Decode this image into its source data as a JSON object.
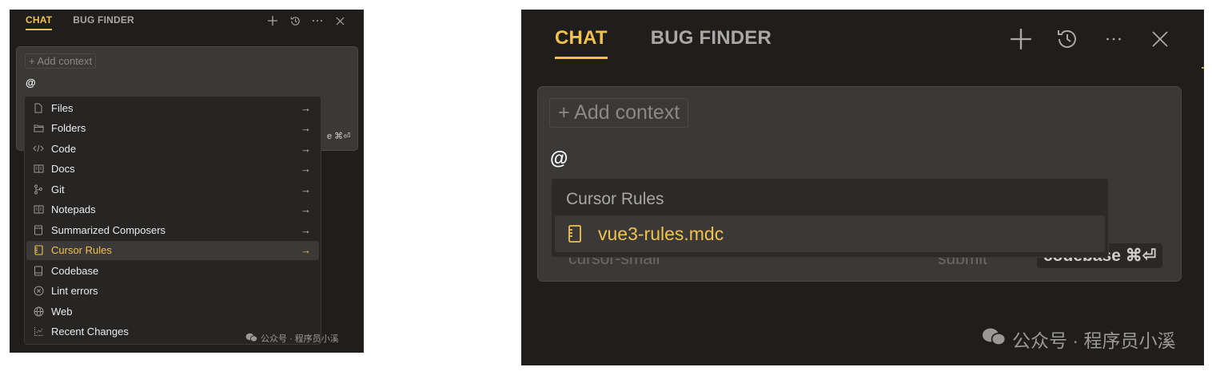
{
  "left_panel": {
    "tabs": [
      {
        "label": "CHAT",
        "active": true
      },
      {
        "label": "BUG FINDER",
        "active": false
      }
    ],
    "toolbar_icons": [
      "plus-icon",
      "history-icon",
      "more-icon",
      "close-icon"
    ],
    "add_context": "+ Add context",
    "input_value": "@",
    "behind_menu_hint": "e ⌘⏎",
    "menu_items": [
      {
        "label": "Files",
        "icon": "file-icon",
        "arrow": "→"
      },
      {
        "label": "Folders",
        "icon": "folder-icon",
        "arrow": "→"
      },
      {
        "label": "Code",
        "icon": "code-icon",
        "arrow": "→"
      },
      {
        "label": "Docs",
        "icon": "docs-icon",
        "arrow": "→"
      },
      {
        "label": "Git",
        "icon": "git-icon",
        "arrow": "→"
      },
      {
        "label": "Notepads",
        "icon": "notepad-icon",
        "arrow": "→"
      },
      {
        "label": "Summarized Composers",
        "icon": "composer-icon",
        "arrow": "→"
      },
      {
        "label": "Cursor Rules",
        "icon": "rules-icon",
        "arrow": "→",
        "selected": true
      },
      {
        "label": "Codebase",
        "icon": "codebase-icon"
      },
      {
        "label": "Lint errors",
        "icon": "lint-icon"
      },
      {
        "label": "Web",
        "icon": "globe-icon"
      },
      {
        "label": "Recent Changes",
        "icon": "changes-icon"
      }
    ],
    "watermark": "公众号 · 程序员小溪"
  },
  "right_panel": {
    "tabs": [
      {
        "label": "CHAT",
        "active": true
      },
      {
        "label": "BUG FINDER",
        "active": false
      }
    ],
    "toolbar_icons": [
      "plus-icon",
      "history-icon",
      "more-icon",
      "close-icon"
    ],
    "add_context": "+ Add context",
    "input_value": "@",
    "menu_header": "Cursor Rules",
    "menu_item": "vue3-rules.mdc",
    "faded_left": "cursor-small",
    "faded_right": "submit",
    "codebase_hint": "codebase ⌘⏎",
    "watermark": "公众号 · 程序员小溪"
  },
  "colors": {
    "accent": "#f2c14e",
    "panel_bg": "#1f1e1d",
    "input_bg": "#3a3937"
  }
}
